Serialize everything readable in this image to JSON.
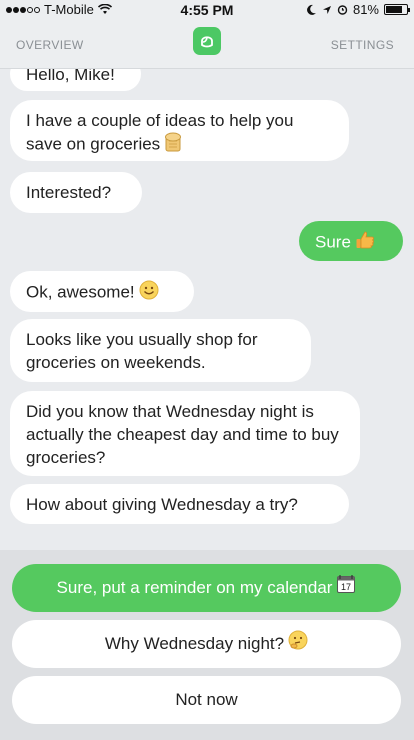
{
  "status_bar": {
    "carrier": "T-Mobile",
    "time": "4:55 PM",
    "battery": "81%",
    "battery_level": 0.81,
    "signal_bars_filled": 3,
    "signal_bars_total": 5
  },
  "nav": {
    "overview": "OVERVIEW",
    "settings": "SETTINGS",
    "logo_icon": "app-logo-icon"
  },
  "messages": [
    {
      "from": "bot",
      "text": "Hello, Mike!"
    },
    {
      "from": "bot",
      "text": "I have a couple of ideas to help you save on groceries",
      "emoji": "bread-icon"
    },
    {
      "from": "bot",
      "text": "Interested?"
    },
    {
      "from": "user",
      "text": "Sure",
      "emoji": "thumbs-up-icon"
    },
    {
      "from": "bot",
      "text": "Ok, awesome!",
      "emoji": "smiley-icon"
    },
    {
      "from": "bot",
      "text": "Looks like you usually shop for groceries on weekends."
    },
    {
      "from": "bot",
      "text": "Did you know that Wednesday night is actually the cheapest day and time to buy groceries?"
    },
    {
      "from": "bot",
      "text": "How about giving Wednesday a try?"
    }
  ],
  "options": [
    {
      "label": "Sure, put a reminder on my calendar",
      "emoji": "calendar-icon",
      "calendar_day": "17"
    },
    {
      "label": "Why Wednesday night?",
      "emoji": "thinking-face-icon"
    },
    {
      "label": "Not now"
    }
  ],
  "colors": {
    "accent": "#55c95f",
    "background": "#e9ebee",
    "panel": "#dddfe2"
  }
}
